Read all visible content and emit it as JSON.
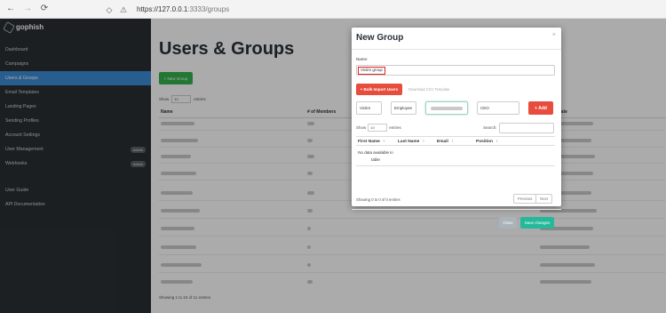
{
  "browser": {
    "url_base": "https://127.0.0.1",
    "url_rest": ":3333/groups"
  },
  "sidebar": {
    "brand": "gophish",
    "items": [
      {
        "label": "Dashboard"
      },
      {
        "label": "Campaigns"
      },
      {
        "label": "Users & Groups",
        "active": true
      },
      {
        "label": "Email Templates"
      },
      {
        "label": "Landing Pages"
      },
      {
        "label": "Sending Profiles"
      },
      {
        "label": "Account Settings"
      },
      {
        "label": "User Management",
        "badge": "Admin"
      },
      {
        "label": "Webhooks",
        "badge": "Admin"
      }
    ],
    "bottom_items": [
      {
        "label": "User Guide"
      },
      {
        "label": "API Documentation"
      }
    ]
  },
  "main": {
    "title": "Users & Groups",
    "new_group_label": "+ New Group",
    "show_label": "Show",
    "show_value": "10",
    "entries_label": "entries",
    "columns": {
      "name": "Name",
      "members": "# of Members",
      "date": "t Date"
    },
    "footer_info": "Showing 1 to 10 of 11 entries"
  },
  "modal": {
    "title": "New Group",
    "close_glyph": "×",
    "name_label": "Name:",
    "name_value": "Victim group",
    "bulk_import_label": "+ Bulk Import Users",
    "download_csv_label": "Download CSV Template",
    "first_name_value": "Victim",
    "last_name_value": "Employee",
    "position_value": "CEO",
    "add_label": "+ Add",
    "show_label": "Show",
    "show_value": "10",
    "entries_label": "entries",
    "search_label": "Search:",
    "columns": [
      "First Name",
      "Last Name",
      "Email",
      "Position"
    ],
    "no_data": "No data available in table",
    "info": "Showing 0 to 0 of 0 entries",
    "pager": {
      "previous": "Previous",
      "next": "Next"
    },
    "close_label": "Close",
    "save_label": "Save changes"
  },
  "colors": {
    "sidebar_bg": "#2a2f34",
    "active_item": "#3d8bd6",
    "danger": "#e74c3c",
    "success": "#37b24d",
    "save": "#25b89a"
  }
}
